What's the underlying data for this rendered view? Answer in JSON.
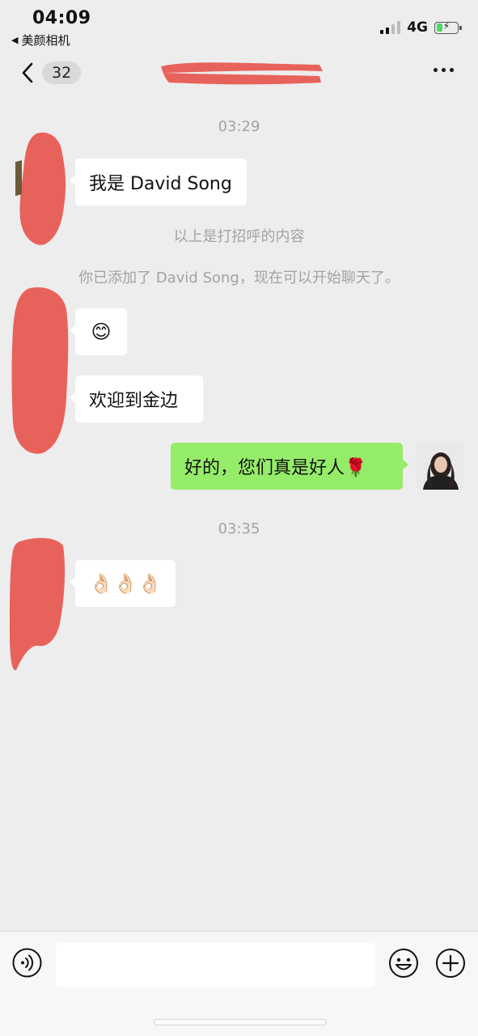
{
  "status_bar": {
    "time": "04:09",
    "back_app": "美颜相机",
    "network": "4G",
    "battery_level": 0.3,
    "battery_color": "#4cd964"
  },
  "nav": {
    "back_icon": "chevron-left-icon",
    "unread_count": "32",
    "title": "",
    "more_icon": "more-dots-icon"
  },
  "chat": {
    "time_1": "03:29",
    "msg_1": "我是 David Song",
    "system_greeting": "以上是打招呼的内容",
    "system_added": "你已添加了 David Song，现在可以开始聊天了。",
    "msg_2_emoji": "😊",
    "msg_3": "欢迎到金边",
    "msg_4": "好的，您们真是好人🌹",
    "time_2": "03:35",
    "msg_5_emoji": "👌🏻👌🏻👌🏻",
    "bubble_color_self": "#95ec69",
    "bubble_color_other": "#ffffff"
  },
  "input_bar": {
    "voice_icon": "voice-icon",
    "message_value": "",
    "sticker_icon": "smiley-icon",
    "plus_icon": "plus-circle-icon"
  },
  "colors": {
    "background": "#ededed",
    "redaction": "#e8625c",
    "muted_text": "#a3a3a3"
  }
}
